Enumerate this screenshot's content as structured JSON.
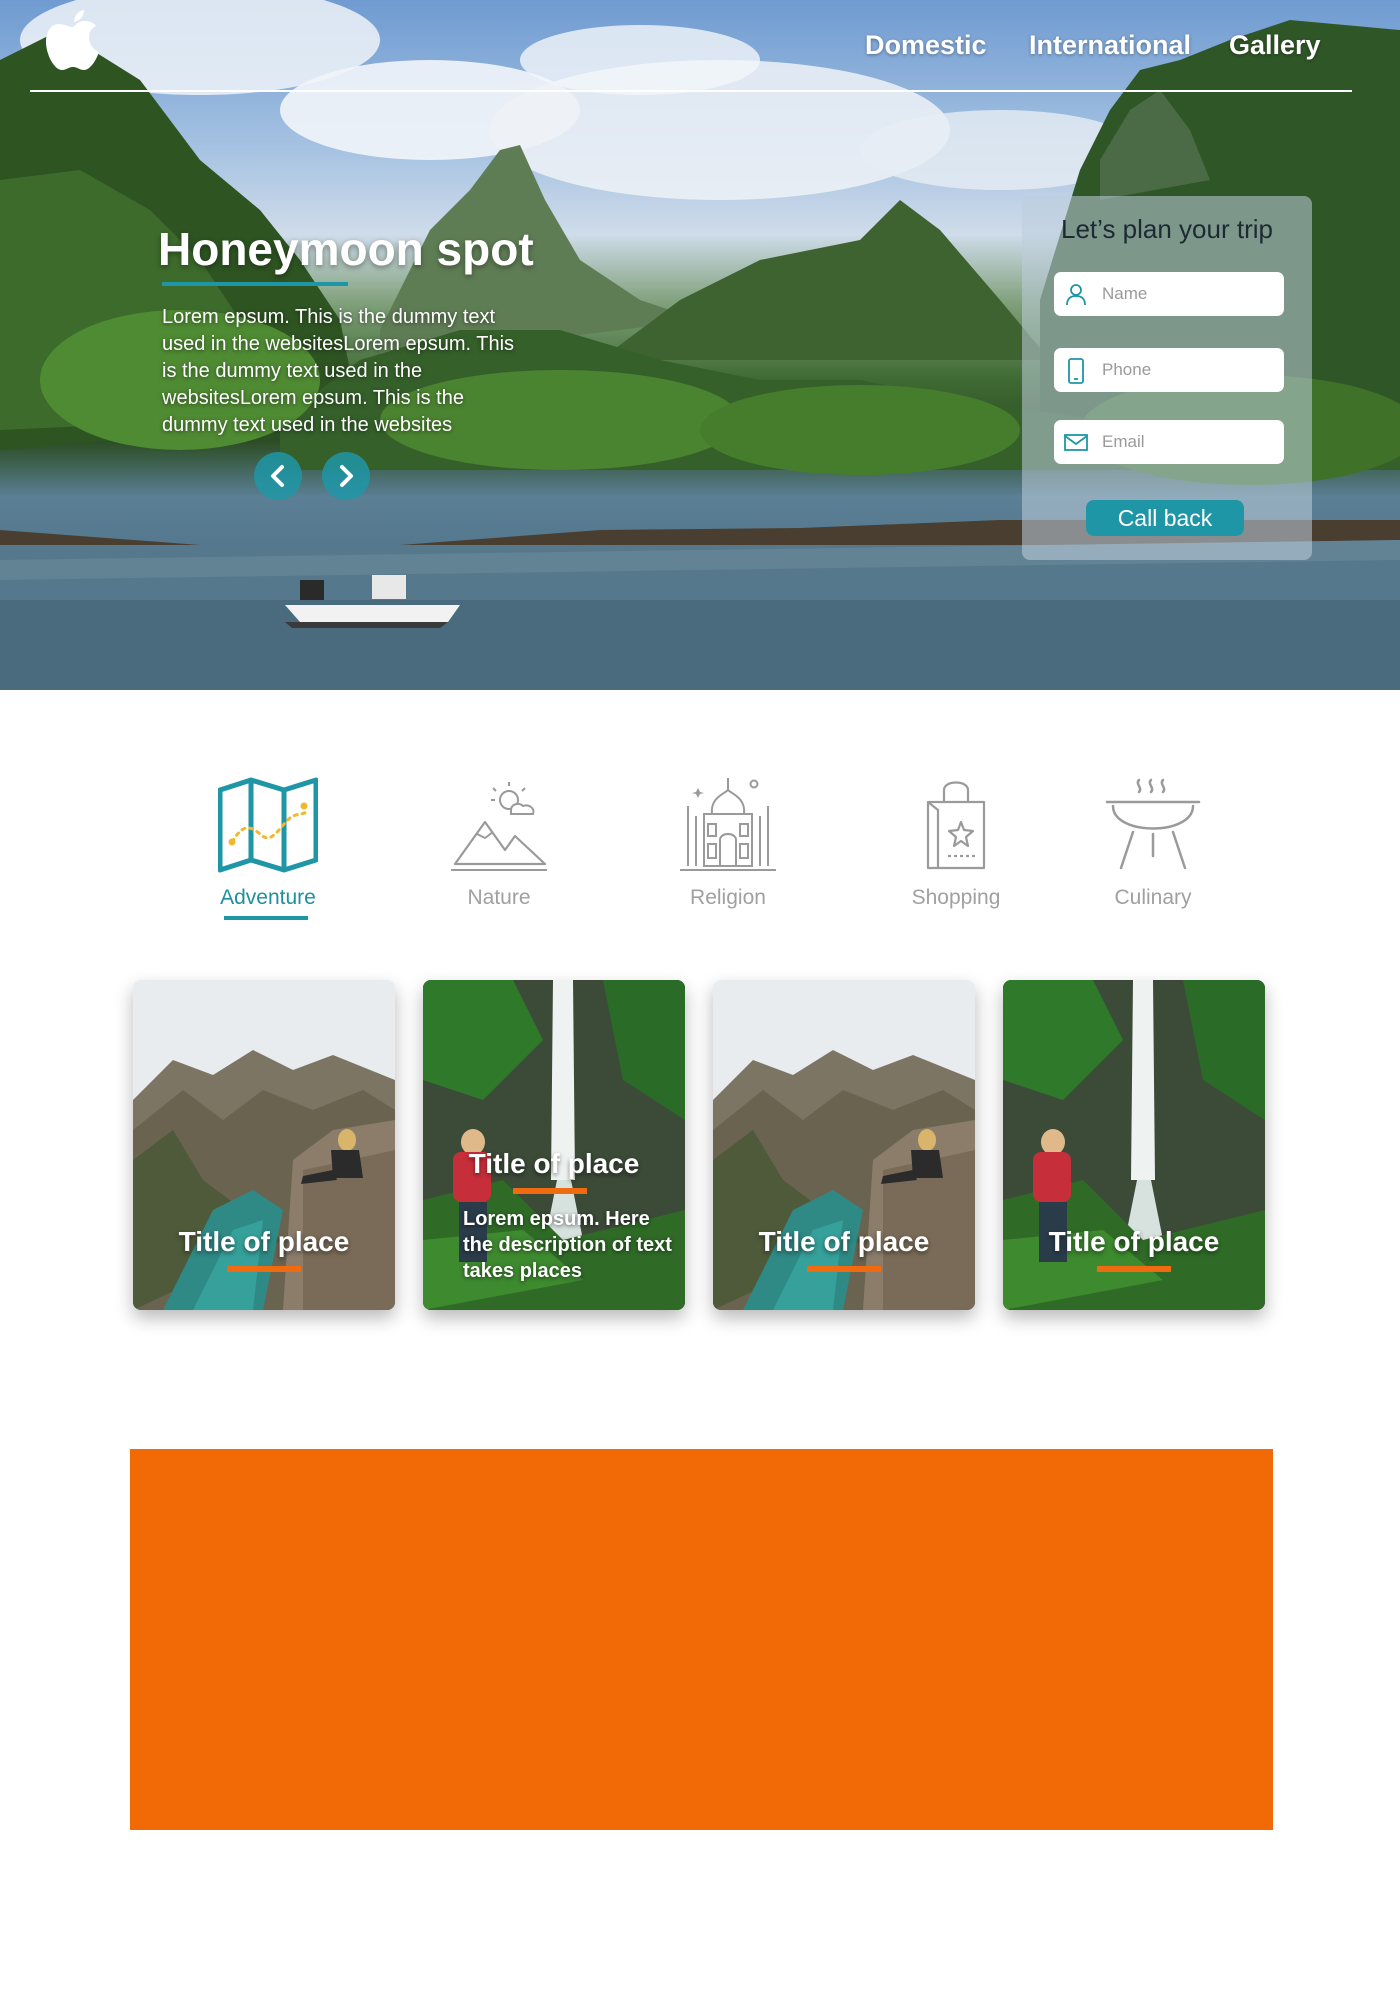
{
  "nav": {
    "items": [
      "Domestic",
      "International",
      "Gallery"
    ]
  },
  "hero": {
    "title": "Honeymoon spot",
    "text": "Lorem epsum. This is the  dummy text used in the websitesLorem epsum. This is the  dummy text used in the websitesLorem epsum. This is the  dummy text used in the websites"
  },
  "plan": {
    "title": "Let’s plan your trip",
    "name_placeholder": "Name",
    "phone_placeholder": "Phone",
    "email_placeholder": "Email",
    "button": "Call back"
  },
  "categories": [
    {
      "label": "Adventure",
      "icon": "map-icon",
      "active": true
    },
    {
      "label": "Nature",
      "icon": "mountain-icon",
      "active": false
    },
    {
      "label": "Religion",
      "icon": "temple-icon",
      "active": false
    },
    {
      "label": "Shopping",
      "icon": "shopping-bag-icon",
      "active": false
    },
    {
      "label": "Culinary",
      "icon": "grill-icon",
      "active": false
    }
  ],
  "cards": [
    {
      "title": "Title of place",
      "description": ""
    },
    {
      "title": "Title of place",
      "description": "Lorem epsum. Here the description of text takes places"
    },
    {
      "title": "Title of place",
      "description": ""
    },
    {
      "title": "Title of place",
      "description": ""
    }
  ],
  "colors": {
    "accent": "#1f96a6",
    "orange": "#f26a06"
  }
}
